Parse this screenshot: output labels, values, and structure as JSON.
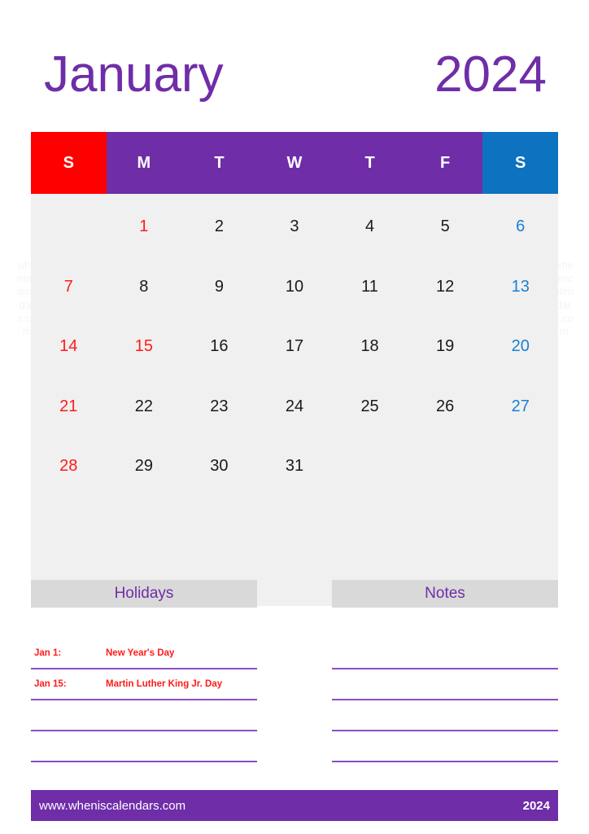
{
  "colors": {
    "purple": "#6f2da8",
    "red": "#ff0000",
    "blue": "#0d72c0",
    "grid_bg": "#f0f0f0",
    "panel_head_bg": "#d9d9d9",
    "line": "#8a4fc4"
  },
  "header": {
    "month": "January",
    "year": "2024"
  },
  "watermark": {
    "text": "wheniscalendars.com"
  },
  "calendar": {
    "weekday_headers": [
      {
        "label": "S",
        "kind": "sun"
      },
      {
        "label": "M",
        "kind": "weekday"
      },
      {
        "label": "T",
        "kind": "weekday"
      },
      {
        "label": "W",
        "kind": "weekday"
      },
      {
        "label": "T",
        "kind": "weekday"
      },
      {
        "label": "F",
        "kind": "weekday"
      },
      {
        "label": "S",
        "kind": "sat"
      }
    ],
    "weeks": [
      [
        {
          "day": "",
          "kind": "empty"
        },
        {
          "day": "1",
          "kind": "holiday"
        },
        {
          "day": "2",
          "kind": "weekday"
        },
        {
          "day": "3",
          "kind": "weekday"
        },
        {
          "day": "4",
          "kind": "weekday"
        },
        {
          "day": "5",
          "kind": "weekday"
        },
        {
          "day": "6",
          "kind": "sat"
        }
      ],
      [
        {
          "day": "7",
          "kind": "sun"
        },
        {
          "day": "8",
          "kind": "weekday"
        },
        {
          "day": "9",
          "kind": "weekday"
        },
        {
          "day": "10",
          "kind": "weekday"
        },
        {
          "day": "11",
          "kind": "weekday"
        },
        {
          "day": "12",
          "kind": "weekday"
        },
        {
          "day": "13",
          "kind": "sat"
        }
      ],
      [
        {
          "day": "14",
          "kind": "sun"
        },
        {
          "day": "15",
          "kind": "holiday"
        },
        {
          "day": "16",
          "kind": "weekday"
        },
        {
          "day": "17",
          "kind": "weekday"
        },
        {
          "day": "18",
          "kind": "weekday"
        },
        {
          "day": "19",
          "kind": "weekday"
        },
        {
          "day": "20",
          "kind": "sat"
        }
      ],
      [
        {
          "day": "21",
          "kind": "sun"
        },
        {
          "day": "22",
          "kind": "weekday"
        },
        {
          "day": "23",
          "kind": "weekday"
        },
        {
          "day": "24",
          "kind": "weekday"
        },
        {
          "day": "25",
          "kind": "weekday"
        },
        {
          "day": "26",
          "kind": "weekday"
        },
        {
          "day": "27",
          "kind": "sat"
        }
      ],
      [
        {
          "day": "28",
          "kind": "sun"
        },
        {
          "day": "29",
          "kind": "weekday"
        },
        {
          "day": "30",
          "kind": "weekday"
        },
        {
          "day": "31",
          "kind": "weekday"
        },
        {
          "day": "",
          "kind": "empty"
        },
        {
          "day": "",
          "kind": "empty"
        },
        {
          "day": "",
          "kind": "empty"
        }
      ],
      [
        {
          "day": "",
          "kind": "empty"
        },
        {
          "day": "",
          "kind": "empty"
        },
        {
          "day": "",
          "kind": "empty"
        },
        {
          "day": "",
          "kind": "empty"
        },
        {
          "day": "",
          "kind": "empty"
        },
        {
          "day": "",
          "kind": "empty"
        },
        {
          "day": "",
          "kind": "empty"
        }
      ]
    ]
  },
  "holidays_panel": {
    "title": "Holidays",
    "rows": [
      {
        "date": "Jan 1:",
        "name": "New Year's Day"
      },
      {
        "date": "Jan 15:",
        "name": "Martin Luther King Jr. Day"
      },
      {
        "date": "",
        "name": ""
      },
      {
        "date": "",
        "name": ""
      },
      {
        "date": "",
        "name": ""
      }
    ]
  },
  "notes_panel": {
    "title": "Notes",
    "rows": [
      {
        "date": "",
        "name": ""
      },
      {
        "date": "",
        "name": ""
      },
      {
        "date": "",
        "name": ""
      },
      {
        "date": "",
        "name": ""
      },
      {
        "date": "",
        "name": ""
      }
    ]
  },
  "footer": {
    "site": "www.wheniscalendars.com",
    "year": "2024"
  }
}
